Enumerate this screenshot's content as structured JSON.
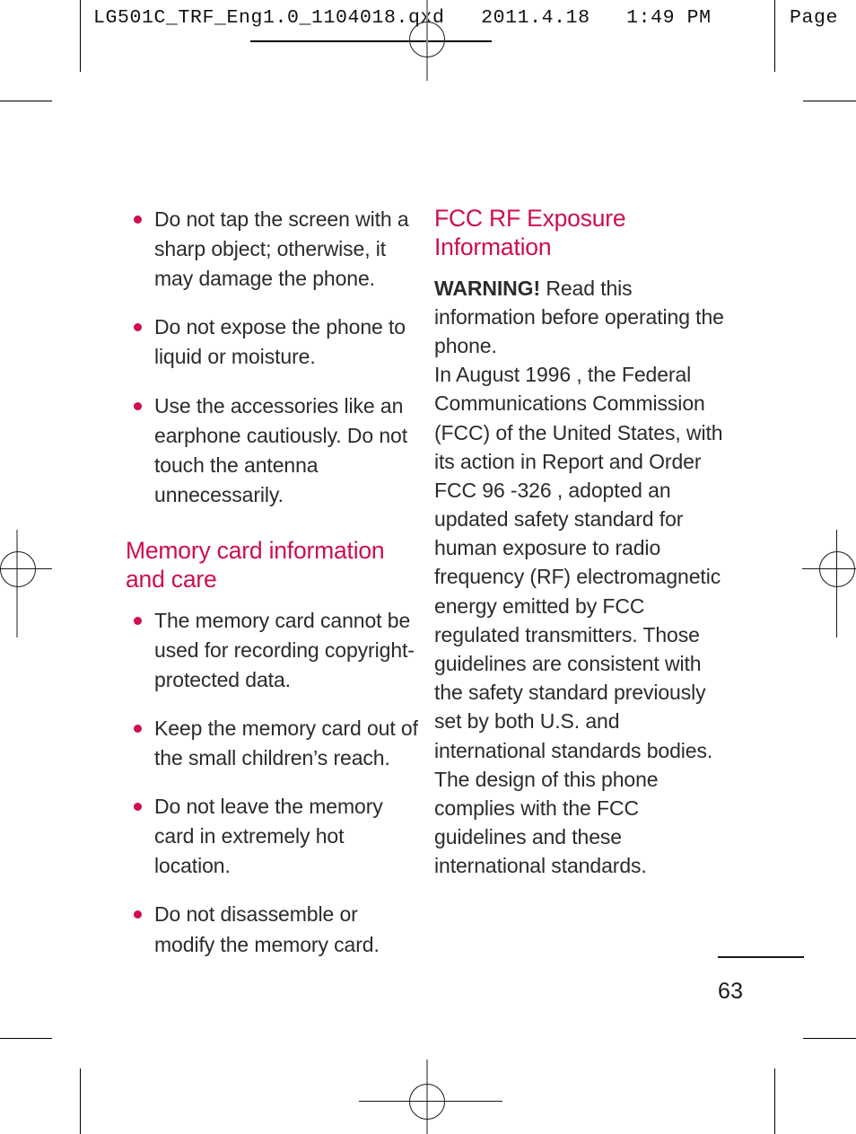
{
  "prepress": {
    "header_text": "LG501C_TRF_Eng1.0_1104018.qxd   2011.4.18   1:49 PM",
    "page_label": "Page"
  },
  "left_column": {
    "top_bullets": [
      "Do not tap the screen with a sharp object; otherwise, it may damage the phone.",
      "Do not expose the phone to liquid or moisture.",
      "Use the accessories like an earphone cautiously. Do not touch the antenna unnecessarily."
    ],
    "heading": "Memory card information and care",
    "bullets": [
      "The memory card cannot be used for recording copyright- protected data.",
      "Keep the memory card out of the small children’s reach.",
      "Do not leave the memory card in extremely hot location.",
      "Do not disassemble or modify the memory card."
    ]
  },
  "right_column": {
    "heading": "FCC RF Exposure Information",
    "warning_label": "WARNING!",
    "warning_text": " Read this information before operating the phone.",
    "paragraph": "In August 1996 , the Federal Communications Commission (FCC) of the United States, with its action in Report and Order FCC 96 -326 , adopted an updated safety standard for human exposure to radio frequency (RF) electromagnetic energy emitted by FCC regulated transmitters. Those guidelines are consistent with the safety standard previously set by both U.S. and international standards bodies. The design of this phone complies with the FCC guidelines and these international standards."
  },
  "footer": {
    "page_number": "63"
  },
  "colors": {
    "accent": "#CE0E4E",
    "body_text": "#2B2B2B",
    "mark": "#000000"
  }
}
